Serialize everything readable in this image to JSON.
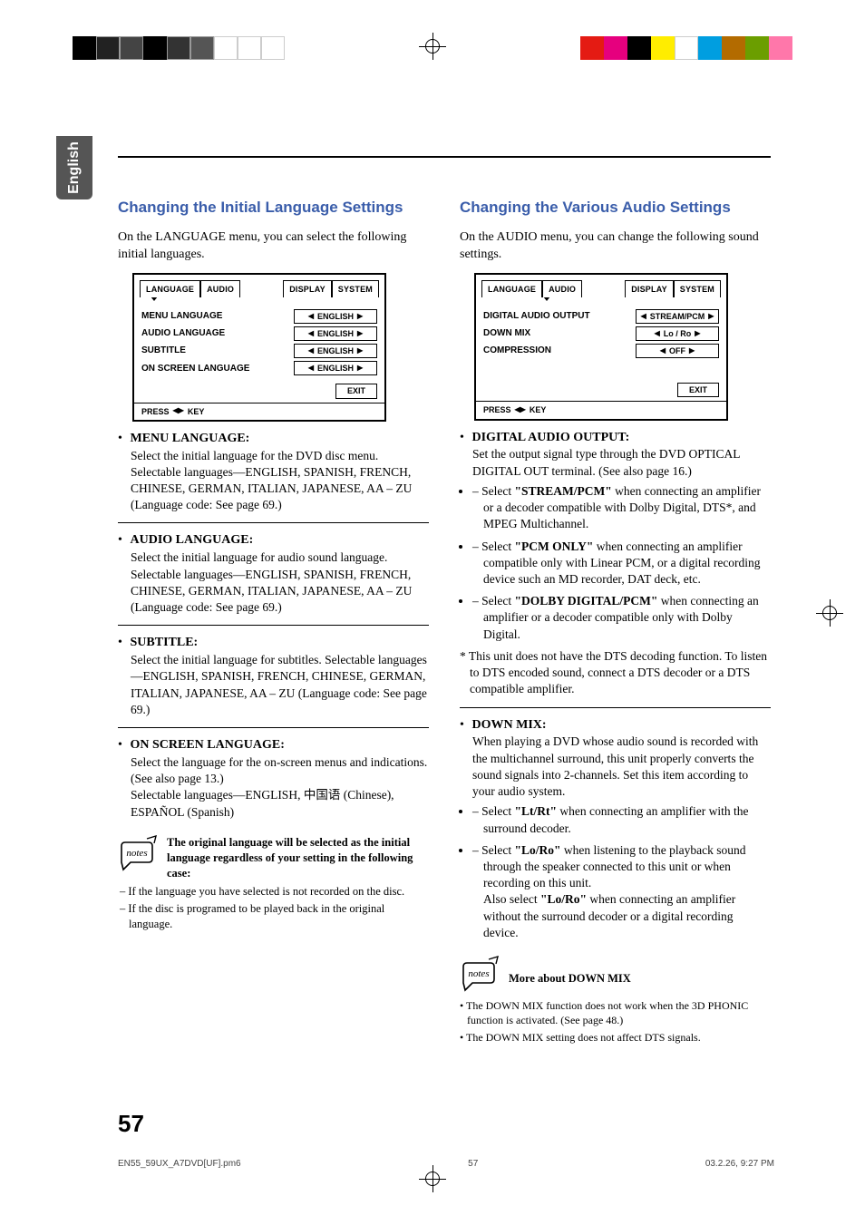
{
  "side_tab": "English",
  "left": {
    "heading": "Changing the Initial Language Settings",
    "intro": "On the LANGUAGE menu, you can select the following initial languages.",
    "menu": {
      "tabs": [
        "LANGUAGE",
        "AUDIO",
        "DISPLAY",
        "SYSTEM"
      ],
      "rows": [
        {
          "label": "MENU LANGUAGE",
          "value": "ENGLISH"
        },
        {
          "label": "AUDIO LANGUAGE",
          "value": "ENGLISH"
        },
        {
          "label": "SUBTITLE",
          "value": "ENGLISH"
        },
        {
          "label": "ON SCREEN LANGUAGE",
          "value": "ENGLISH"
        }
      ],
      "exit": "EXIT",
      "press": "PRESS",
      "press_suffix": "KEY"
    },
    "items": [
      {
        "title": "MENU LANGUAGE:",
        "body": "Select the initial language for the DVD disc menu. Selectable languages—ENGLISH, SPANISH, FRENCH, CHINESE, GERMAN, ITALIAN, JAPANESE, AA – ZU (Language code: See page 69.)"
      },
      {
        "title": "AUDIO LANGUAGE:",
        "body": "Select the initial language for audio sound language. Selectable languages—ENGLISH, SPANISH, FRENCH, CHINESE, GERMAN, ITALIAN, JAPANESE, AA – ZU (Language code: See page 69.)"
      },
      {
        "title": "SUBTITLE:",
        "body": "Select the initial language for subtitles. Selectable languages—ENGLISH, SPANISH, FRENCH, CHINESE, GERMAN, ITALIAN, JAPANESE, AA – ZU (Language code: See page 69.)"
      },
      {
        "title": "ON SCREEN LANGUAGE:",
        "body_pre": "Select the language for the on-screen menus and indications. (See also page 13.)\nSelectable languages—ENGLISH, ",
        "body_cjk": "中国语",
        "body_post": " (Chinese), ESPAÑOL (Spanish)"
      }
    ],
    "note_strong": "The original language will be selected as the initial language regardless of your setting in the following case:",
    "note_bullets": [
      "– If the language you have selected is not recorded on the disc.",
      "– If the disc is programed to be played back in the original language."
    ]
  },
  "right": {
    "heading": "Changing the Various Audio Settings",
    "intro": "On the AUDIO menu, you can change the following sound settings.",
    "menu": {
      "tabs": [
        "LANGUAGE",
        "AUDIO",
        "DISPLAY",
        "SYSTEM"
      ],
      "rows": [
        {
          "label": "DIGITAL AUDIO OUTPUT",
          "value": "STREAM/PCM"
        },
        {
          "label": "DOWN MIX",
          "value": "Lo / Ro"
        },
        {
          "label": "COMPRESSION",
          "value": "OFF"
        }
      ],
      "exit": "EXIT",
      "press": "PRESS",
      "press_suffix": "KEY"
    },
    "items": [
      {
        "title": "DIGITAL AUDIO OUTPUT:",
        "body": "Set the output signal type through the DVD OPTICAL DIGITAL OUT terminal. (See also page 16.)",
        "subs": [
          {
            "pre": "– Select ",
            "bold": "\"STREAM/PCM\"",
            "post": " when connecting an amplifier or a decoder compatible with Dolby Digital, DTS*, and MPEG Multichannel."
          },
          {
            "pre": "– Select ",
            "bold": "\"PCM ONLY\"",
            "post": " when connecting an amplifier compatible only with Linear PCM, or a digital recording device such an MD recorder, DAT deck, etc."
          },
          {
            "pre": "– Select ",
            "bold": "\"DOLBY DIGITAL/PCM\"",
            "post": " when connecting an amplifier or a decoder compatible only with Dolby Digital."
          }
        ],
        "asterisk": "* This unit does not have the DTS decoding function. To listen to DTS encoded sound, connect a DTS decoder or a DTS compatible amplifier."
      },
      {
        "title": "DOWN MIX:",
        "body": "When playing a DVD whose audio sound is recorded with the multichannel surround, this unit properly converts the sound signals into 2-channels. Set this item according to your audio system.",
        "subs": [
          {
            "pre": "– Select ",
            "bold": "\"Lt/Rt\"",
            "post": " when connecting an amplifier with the surround decoder."
          },
          {
            "pre": "– Select ",
            "bold": "\"Lo/Ro\"",
            "post": " when listening to the playback sound through the speaker connected to this unit or when recording on this unit.",
            "extra_pre": "Also select ",
            "extra_bold": "\"Lo/Ro\"",
            "extra_post": " when connecting an amplifier without the surround decoder or a digital recording device."
          }
        ]
      }
    ],
    "note_strong": "More about DOWN MIX",
    "note_bullets": [
      "• The DOWN MIX function does not work when the 3D PHONIC function is activated. (See page 48.)",
      "• The DOWN MIX setting does not affect DTS signals."
    ]
  },
  "page_number": "57",
  "footer": {
    "file": "EN55_59UX_A7DVD[UF].pm6",
    "page": "57",
    "date": "03.2.26, 9:27 PM"
  }
}
